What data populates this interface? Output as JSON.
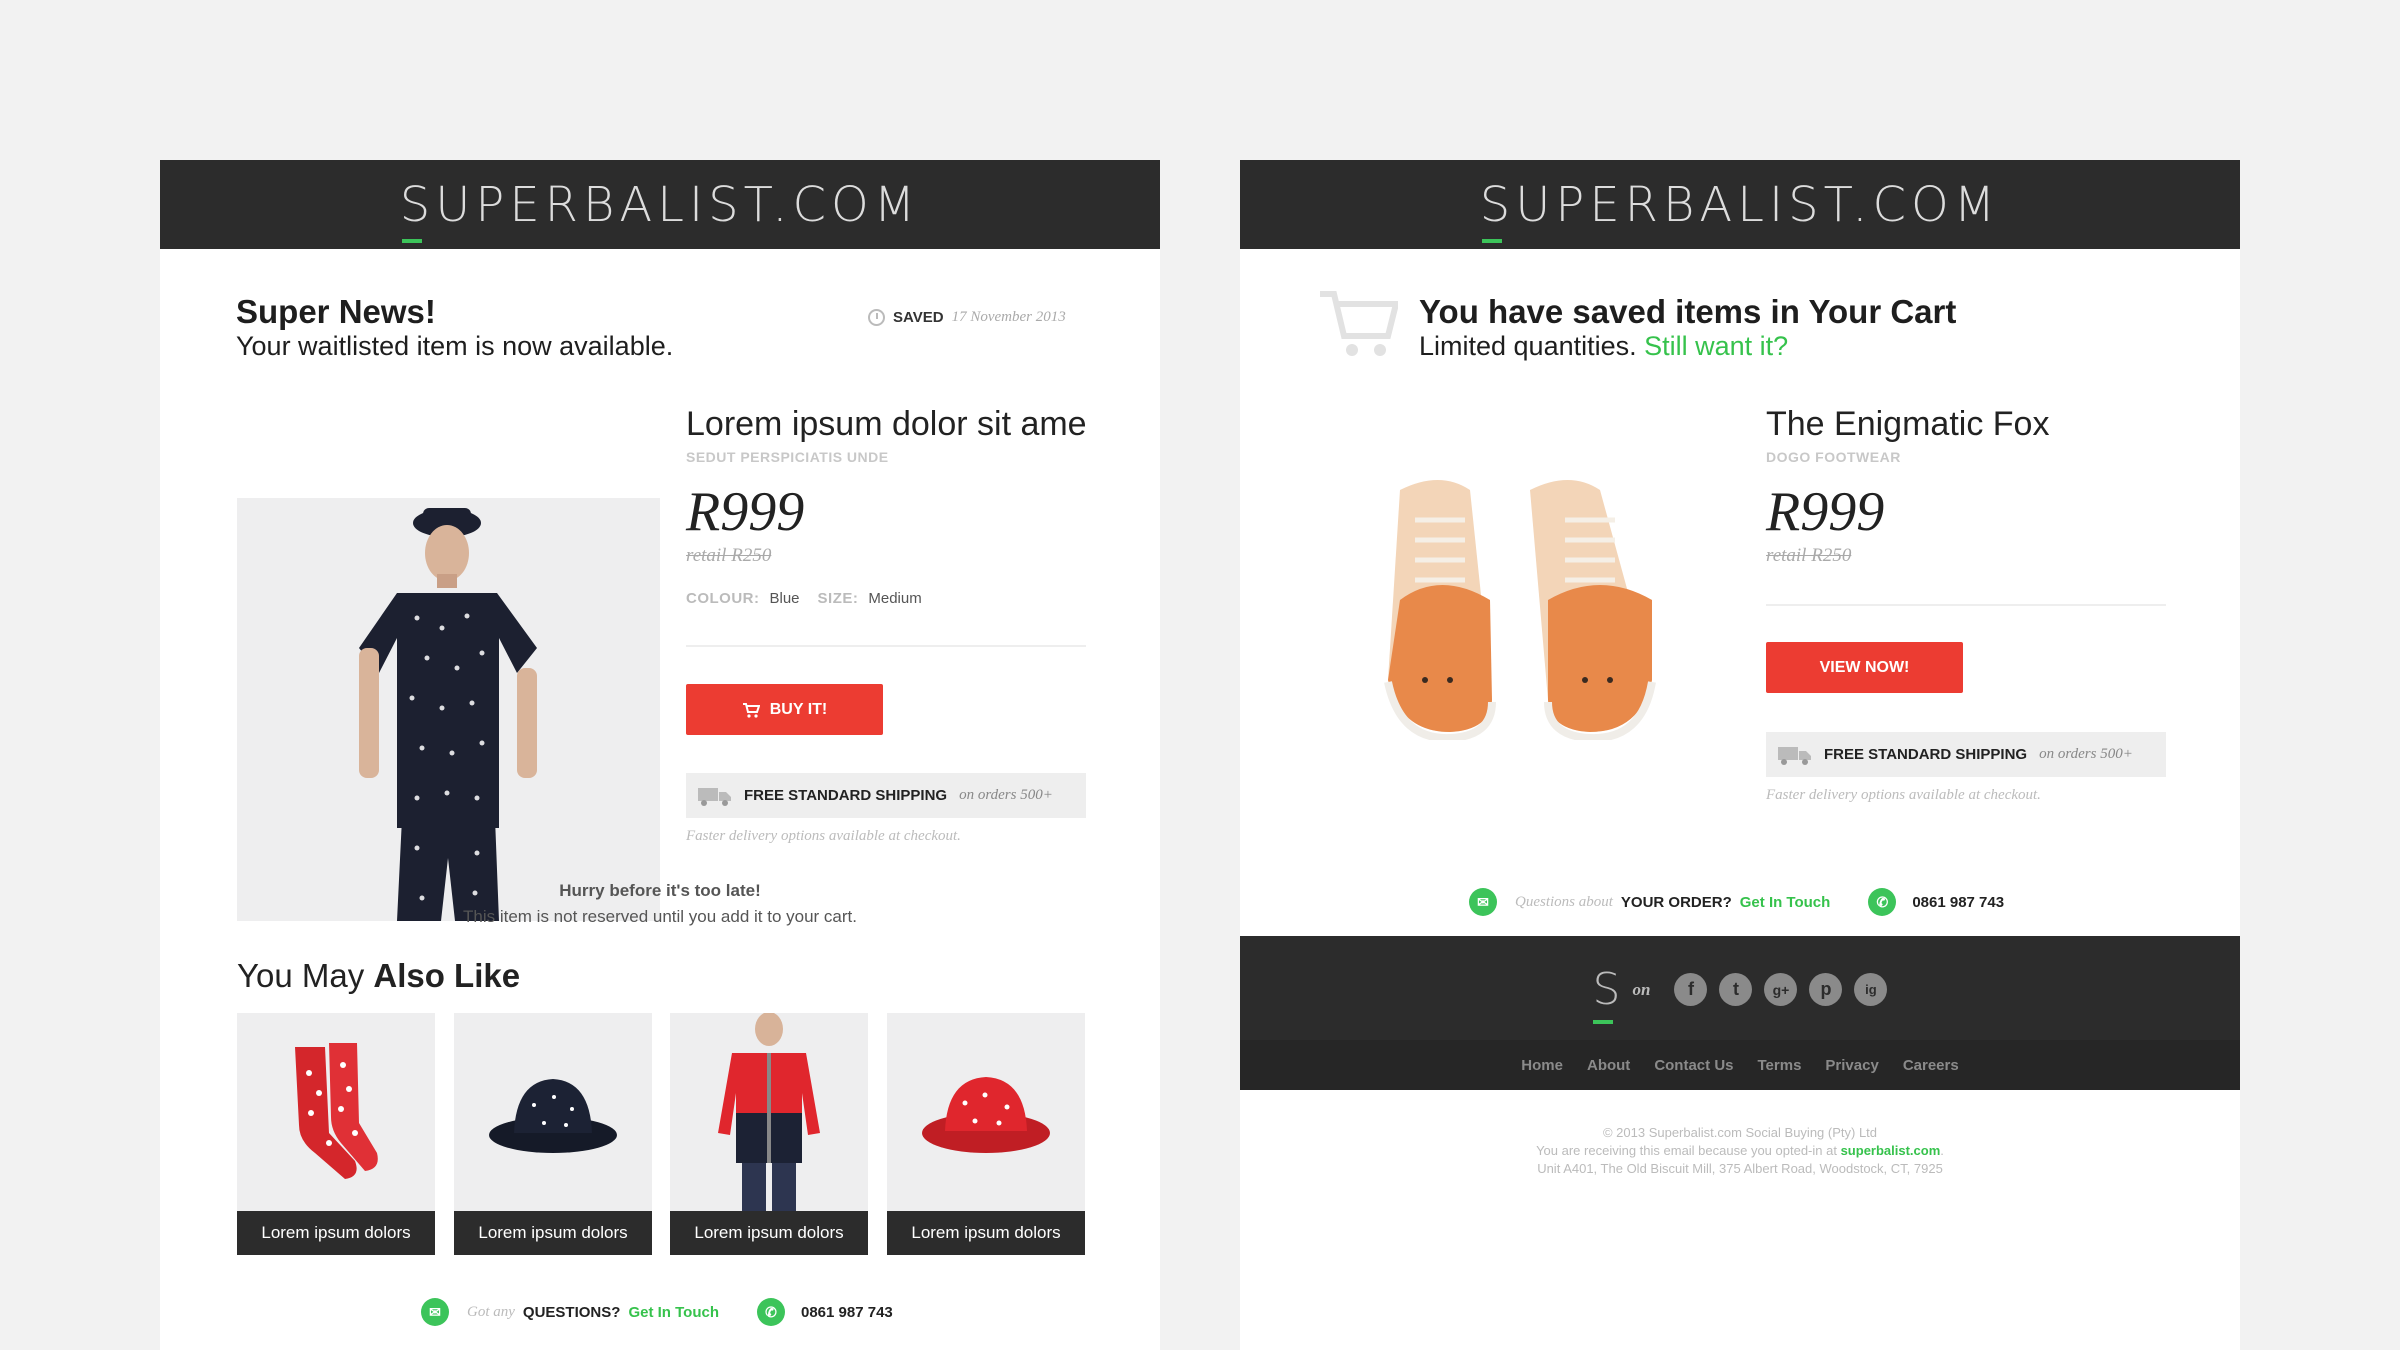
{
  "left": {
    "logo": "SUPERBALIST.COM",
    "title": "Super News!",
    "subtitle": "Your waitlisted item is now available.",
    "saved_label": "SAVED",
    "saved_date": "17 November 2013",
    "product": {
      "name": "Lorem ipsum dolor sit ame",
      "brand": "SEDUT PERSPICIATIS UNDE",
      "price": "R999",
      "retail": "retail R250",
      "colour_label": "COLOUR:",
      "colour_value": "Blue",
      "size_label": "SIZE:",
      "size_value": "Medium",
      "button": "BUY IT!"
    },
    "shipping": {
      "label": "FREE STANDARD SHIPPING",
      "suffix": "on orders 500+",
      "note": "Faster delivery options available at checkout."
    },
    "hurry": "Hurry before it's too late!",
    "not_reserved": "This item is not reserved until you add it to your cart.",
    "also_like_pre": "You May ",
    "also_like_bold": "Also Like",
    "tiles": [
      {
        "label": "Lorem ipsum dolors"
      },
      {
        "label": "Lorem ipsum dolors"
      },
      {
        "label": "Lorem ipsum dolors"
      },
      {
        "label": "Lorem ipsum dolors"
      }
    ],
    "contact": {
      "prefix": "Got any",
      "label": "QUESTIONS?",
      "link": "Get In Touch",
      "phone": "0861 987 743"
    }
  },
  "right": {
    "logo": "SUPERBALIST.COM",
    "title": "You have saved items in Your Cart",
    "subtitle": "Limited quantities.",
    "subtitle_link": "Still want it?",
    "product": {
      "name": "The Enigmatic Fox",
      "brand": "DOGO FOOTWEAR",
      "price": "R999",
      "retail": "retail R250",
      "button": "VIEW NOW!"
    },
    "shipping": {
      "label": "FREE STANDARD SHIPPING",
      "suffix": "on orders 500+",
      "note": "Faster delivery options available at checkout."
    },
    "contact": {
      "prefix": "Questions about",
      "label": "YOUR ORDER?",
      "link": "Get In Touch",
      "phone": "0861 987 743"
    },
    "footer": {
      "s_logo": "S",
      "on": "on",
      "social": [
        "f",
        "t",
        "g+",
        "p",
        "ig"
      ],
      "nav": [
        "Home",
        "About",
        "Contact Us",
        "Terms",
        "Privacy",
        "Careers"
      ],
      "copyright": "© 2013 Superbalist.com Social Buying (Pty) Ltd",
      "receiving": "You are receiving this email because you opted-in at",
      "receiving_link": "superbalist.com",
      "address": "Unit A401, The Old Biscuit Mill, 375 Albert Road, Woodstock, CT, 7925"
    }
  },
  "colors": {
    "header_bg": "#2c2c2c",
    "accent_green": "#36c24c",
    "button_red": "#ec3c32",
    "page_bg": "#f2f2f2"
  }
}
